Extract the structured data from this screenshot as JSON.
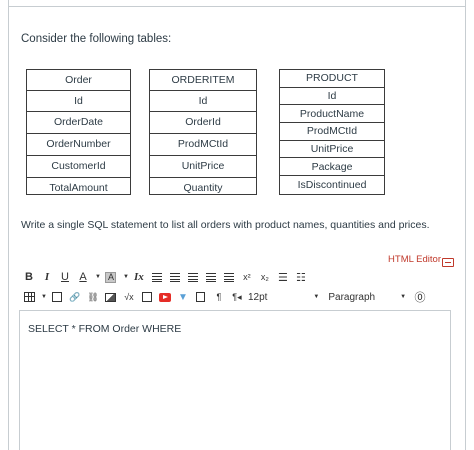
{
  "intro": "Consider the following tables:",
  "tables": [
    {
      "name": "Order",
      "columns": [
        "Id",
        "OrderDate",
        "OrderNumber",
        "CustomerId",
        "TotalAmount"
      ]
    },
    {
      "name": "ORDERITEM",
      "columns": [
        "Id",
        "OrderId",
        "ProdMCtId",
        "UnitPrice",
        "Quantity"
      ]
    },
    {
      "name": "PRODUCT",
      "columns": [
        "Id",
        "ProductName",
        "ProdMCtId",
        "UnitPrice",
        "Package",
        "IsDiscontinued"
      ]
    }
  ],
  "question": "Write a single SQL statement to list all orders with product names, quantities and prices.",
  "editor": {
    "html_editor_link": "HTML Editor",
    "font_size": "12pt",
    "block_format": "Paragraph",
    "content": "SELECT * FROM Order WHERE"
  },
  "toolbar_glyphs": {
    "bold": "B",
    "italic": "I",
    "underline": "U",
    "font_color": "A",
    "highlight": "A",
    "clear_format": "Ix",
    "superscript": "x²",
    "subscript": "x₂",
    "bullet_list": "☰",
    "numbered_list": "☷",
    "link": "🔗",
    "unlink": "⛓",
    "sqrt": "√x",
    "ltr": "¶",
    "rtl": "¶◂",
    "caret": "▼",
    "accessibility": "⓪"
  }
}
